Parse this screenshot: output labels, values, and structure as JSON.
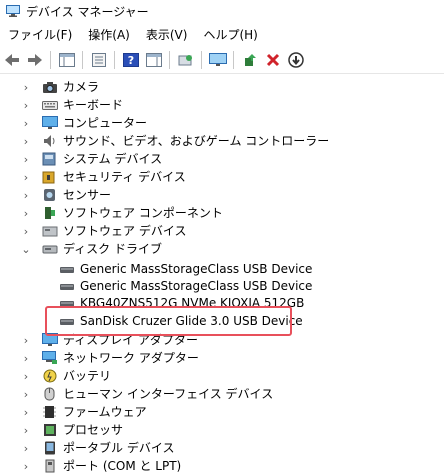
{
  "window": {
    "title": "デバイス マネージャー"
  },
  "menu": {
    "items": [
      "ファイル(F)",
      "操作(A)",
      "表示(V)",
      "ヘルプ(H)"
    ]
  },
  "tree": {
    "categories_top": [
      {
        "label": "カメラ",
        "icon": "camera-icon"
      },
      {
        "label": "キーボード",
        "icon": "keyboard-icon"
      },
      {
        "label": "コンピューター",
        "icon": "computer-icon"
      },
      {
        "label": "サウンド、ビデオ、およびゲーム コントローラー",
        "icon": "speaker-icon"
      },
      {
        "label": "システム デバイス",
        "icon": "system-device-icon"
      },
      {
        "label": "セキュリティ デバイス",
        "icon": "security-device-icon"
      },
      {
        "label": "センサー",
        "icon": "sensor-icon"
      },
      {
        "label": "ソフトウェア コンポーネント",
        "icon": "software-component-icon"
      },
      {
        "label": "ソフトウェア デバイス",
        "icon": "software-device-icon"
      }
    ],
    "disk_drives": {
      "label": "ディスク ドライブ",
      "children": [
        "Generic MassStorageClass USB Device",
        "Generic MassStorageClass USB Device",
        "KBG40ZNS512G NVMe KIOXIA 512GB",
        "SanDisk Cruzer Glide 3.0 USB Device"
      ]
    },
    "categories_bottom": [
      {
        "label": "ディスプレイ アダプター",
        "icon": "display-adapter-icon"
      },
      {
        "label": "ネットワーク アダプター",
        "icon": "network-adapter-icon"
      },
      {
        "label": "バッテリ",
        "icon": "battery-icon"
      },
      {
        "label": "ヒューマン インターフェイス デバイス",
        "icon": "hid-icon"
      },
      {
        "label": "ファームウェア",
        "icon": "firmware-icon"
      },
      {
        "label": "プロセッサ",
        "icon": "processor-icon"
      },
      {
        "label": "ポータブル デバイス",
        "icon": "portable-device-icon"
      },
      {
        "label": "ポート (COM と LPT)",
        "icon": "port-icon"
      }
    ]
  }
}
